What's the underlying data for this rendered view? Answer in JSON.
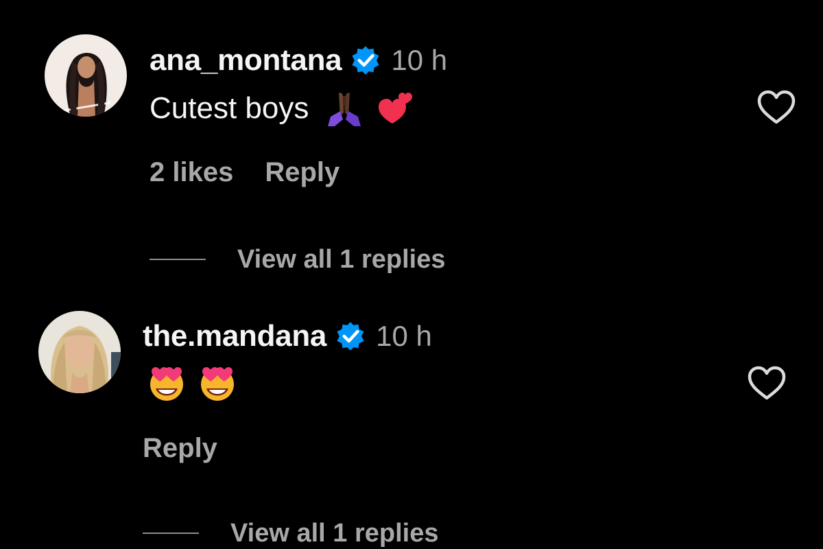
{
  "colors": {
    "background": "#000000",
    "text_primary": "#f5f5f5",
    "text_secondary": "#a8a8a8",
    "verified_blue": "#0095f6",
    "heart_outline": "#dbdbdb"
  },
  "comments": [
    {
      "username": "ana_montana",
      "verified": true,
      "timestamp": "10 h",
      "text": "Cutest boys",
      "emojis": [
        "folded-hands-emoji",
        "two-hearts-emoji"
      ],
      "likes_label": "2 likes",
      "reply_label": "Reply",
      "view_replies_label": "View all 1 replies",
      "avatar_icon": "avatar-photo",
      "like_icon": "heart-outline-icon"
    },
    {
      "username": "the.mandana",
      "verified": true,
      "timestamp": "10 h",
      "text": "",
      "emojis": [
        "heart-eyes-emoji",
        "heart-eyes-emoji"
      ],
      "likes_label": "",
      "reply_label": "Reply",
      "view_replies_label": "View all 1 replies",
      "avatar_icon": "avatar-photo",
      "like_icon": "heart-outline-icon"
    }
  ]
}
